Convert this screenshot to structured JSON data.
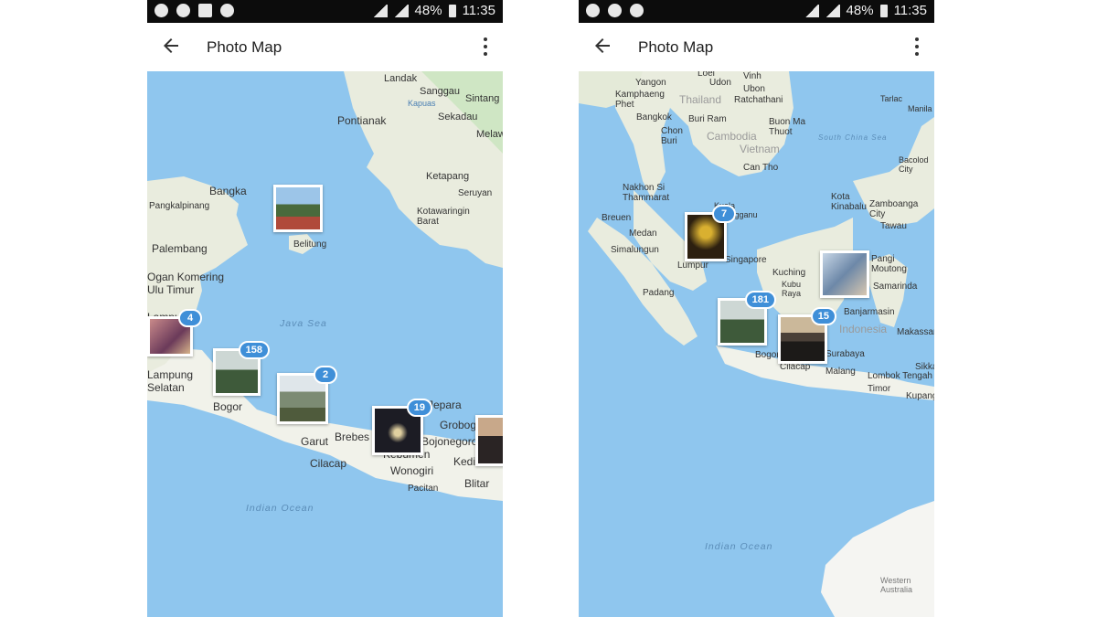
{
  "left_screen": {
    "status_bar": {
      "battery": "48%",
      "time": "11:35"
    },
    "app_bar": {
      "title": "Photo Map"
    },
    "labels": [
      "Landak",
      "Sanggau",
      "Sintang",
      "Kapuas",
      "Sekadau",
      "Pontianak",
      "Melawi",
      "Ketapang",
      "Seruyan",
      "Kotawaringin Barat",
      "Bangka",
      "Pangkalpinang",
      "Belitung",
      "Palembang",
      "Ogan Komering Ulu Timur",
      "Lampung Tengah",
      "Lampung Selatan",
      "Java Sea",
      "Bogor",
      "Garut",
      "Brebes",
      "Cilacap",
      "Jepara",
      "Grobogan",
      "Bojonegoro",
      "Kebumen",
      "Wonogiri",
      "Kediri",
      "Blitar",
      "Pacitan",
      "Indian Ocean"
    ],
    "photos": [
      {
        "name": "photo-belitung",
        "count": ""
      },
      {
        "name": "photo-lampung",
        "count": "4"
      },
      {
        "name": "photo-bogor",
        "count": "158"
      },
      {
        "name": "photo-bandung",
        "count": "2"
      },
      {
        "name": "photo-kebumen",
        "count": "19"
      },
      {
        "name": "photo-east",
        "count": ""
      }
    ]
  },
  "right_screen": {
    "status_bar": {
      "battery": "48%",
      "time": "11:35"
    },
    "app_bar": {
      "title": "Photo Map"
    },
    "labels": [
      "Loei",
      "Vinh",
      "Yangon",
      "Udon",
      "Ubon",
      "Kamphaeng Phet",
      "Thailand",
      "Ratchathani",
      "Bangkok",
      "Buri Ram",
      "Buon Ma Thuot",
      "Chon Buri",
      "Cambodia",
      "Vietnam",
      "Can Tho",
      "South China Sea",
      "Tarlac",
      "Manila",
      "Bacolod City",
      "Nakhon Si Thammarat",
      "Kuala Terengganu",
      "Kota Kinabalu",
      "Zamboanga City",
      "Tawau",
      "Breuen",
      "Medan",
      "Simalungun",
      "Lumpur",
      "Singapore",
      "Kuching",
      "Kubu Raya",
      "Pangi Moutong",
      "Padang",
      "Samarinda",
      "Indonesia",
      "Banjarmasin",
      "Makassar",
      "Bogor",
      "Cilacap",
      "Malang",
      "Surabaya",
      "Lombok Tengah",
      "Sikka",
      "Kupang",
      "Timor",
      "Indian Ocean",
      "Western Australia"
    ],
    "photos": [
      {
        "name": "photo-malaysia",
        "count": "7"
      },
      {
        "name": "photo-java-west",
        "count": "181"
      },
      {
        "name": "photo-java-central",
        "count": "15"
      },
      {
        "name": "photo-borneo",
        "count": ""
      }
    ]
  }
}
